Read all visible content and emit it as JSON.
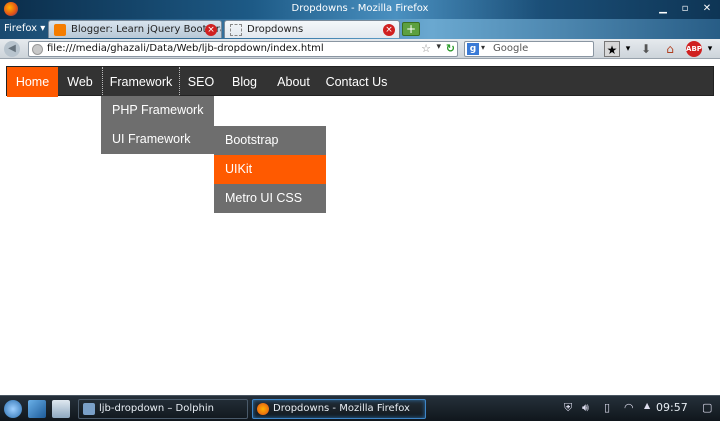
{
  "window": {
    "title": "Dropdowns - Mozilla Firefox",
    "firefox_menu": "Firefox"
  },
  "tabs": [
    {
      "label": "Blogger: Learn jQuery Bootstra...",
      "icon": "blogger-icon",
      "active": false
    },
    {
      "label": "Dropdowns",
      "icon": "page-loading-icon",
      "active": true
    }
  ],
  "navigation": {
    "url": "file:///media/ghazali/Data/Web/ljb-dropdown/index.html",
    "search_placeholder": "Google"
  },
  "page": {
    "menu": [
      {
        "label": "Home",
        "active": true
      },
      {
        "label": "Web",
        "active": false
      },
      {
        "label": "Framework",
        "active": false,
        "open": true
      },
      {
        "label": "SEO",
        "active": false
      },
      {
        "label": "Blog",
        "active": false
      },
      {
        "label": "About",
        "active": false
      },
      {
        "label": "Contact Us",
        "active": false
      }
    ],
    "framework_dropdown": [
      {
        "label": "PHP Framework"
      },
      {
        "label": "UI Framework",
        "has_submenu": true
      }
    ],
    "ui_framework_submenu": [
      {
        "label": "Bootstrap",
        "highlighted": false
      },
      {
        "label": "UIKit",
        "highlighted": true
      },
      {
        "label": "Metro UI CSS",
        "highlighted": false
      }
    ],
    "colors": {
      "menu_bg": "#333333",
      "accent": "#ff5a00",
      "dropdown_bg": "#6e6e6e"
    }
  },
  "taskbar": {
    "tasks": [
      {
        "label": "ljb-dropdown – Dolphin",
        "icon": "dolphin-icon",
        "active": false
      },
      {
        "label": "Dropdowns - Mozilla Firefox",
        "icon": "firefox-icon",
        "active": true
      }
    ],
    "clock": "09:57"
  }
}
